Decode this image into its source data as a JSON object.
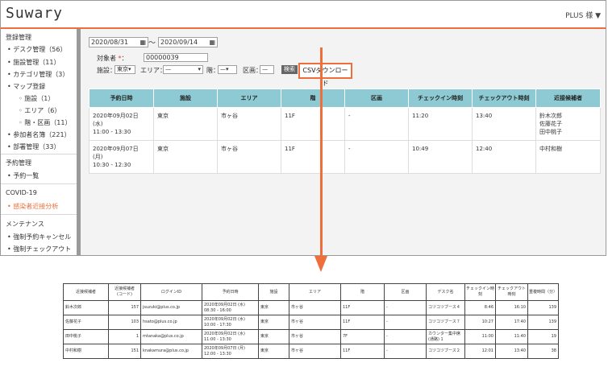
{
  "app": {
    "logo": "Suwary",
    "user": "PLUS 様 ▼"
  },
  "sidebar": {
    "sections": [
      {
        "title": "登録管理",
        "items": [
          "デスク管理（56）",
          "施設管理（11）",
          "カテゴリ管理（3）",
          "マップ登録"
        ],
        "subitems": [
          "施設（1）",
          "エリア（6）",
          "階・区画（11）"
        ],
        "after": [
          "参加者名簿（221）",
          "部署管理（33）"
        ]
      },
      {
        "title": "予約管理",
        "items": [
          "予約一覧"
        ]
      },
      {
        "title": "COVID-19",
        "items": [
          "感染者近接分析"
        ]
      },
      {
        "title": "メンテナンス",
        "items": [
          "強制予約キャンセル",
          "強制チェックアウト"
        ]
      }
    ]
  },
  "search": {
    "date_from": "2020/08/31",
    "date_to": "2020/09/14",
    "tilde": "〜",
    "target_label": "対象者",
    "required_mark": "*",
    "target_value": "00000039",
    "facility_label": "施設：",
    "facility_value": "東京",
    "area_label": "エリア：",
    "area_value": "—",
    "floor_label": "階：",
    "floor_value": "—",
    "section_label": "区画：",
    "section_value": "—",
    "search_button": "検索",
    "csv_button": "CSVダウンロード"
  },
  "results": {
    "headers": [
      "予約日時",
      "施設",
      "エリア",
      "階",
      "区画",
      "チェックイン時刻",
      "チェックアウト時刻",
      "近接候補者"
    ],
    "rows": [
      [
        "2020年09月02日 (水)\n11:00 - 13:30",
        "東京",
        "市ヶ谷",
        "11F",
        "-",
        "11:20",
        "13:40",
        "鈴木次郎\n佐藤花子\n田中桃子"
      ],
      [
        "2020年09月07日 (月)\n10:30 - 12:30",
        "東京",
        "市ヶ谷",
        "11F",
        "-",
        "10:49",
        "12:40",
        "中村和樹"
      ]
    ]
  },
  "export": {
    "headers": [
      "近接候補者",
      "近接候補者\n(コード)",
      "ログインID",
      "予約日時",
      "施設",
      "エリア",
      "階",
      "区画",
      "デスク名",
      "チェックイン時刻",
      "チェックアウト時刻",
      "重複時間（分）"
    ],
    "rows": [
      [
        "鈴木次郎",
        "157",
        "jsuzuki@plus.co.jp",
        "2020年09月02日 (水)\n08:30 - 16:00",
        "東京",
        "市ヶ谷",
        "11F",
        "-",
        "コツコツブース４",
        "8:46",
        "16:10",
        "139"
      ],
      [
        "佐藤花子",
        "103",
        "hsato@plus.co.jp",
        "2020年09月02日 (水)\n10:00 - 17:30",
        "東京",
        "市ヶ谷",
        "11F",
        "-",
        "コツコツブース７",
        "10:27",
        "17:40",
        "139"
      ],
      [
        "田中桃子",
        "1",
        "mtanaka@plus.co.jp",
        "2020年09月02日 (水)\n11:00 - 13:30",
        "東京",
        "市ヶ谷",
        "7F",
        "-",
        "カウンター集中席\n(通路) 1",
        "11:00",
        "11:40",
        "19"
      ],
      [
        "中村和樹",
        "151",
        "knakamura@plus.co.jp",
        "2020年09月07日 (月)\n12:00 - 13:30",
        "東京",
        "市ヶ谷",
        "11F",
        "-",
        "コツコツブース２",
        "12:01",
        "13:40",
        "38"
      ]
    ]
  },
  "colors": {
    "accent": "#ee6e3c",
    "table_header": "#8ecad3"
  }
}
